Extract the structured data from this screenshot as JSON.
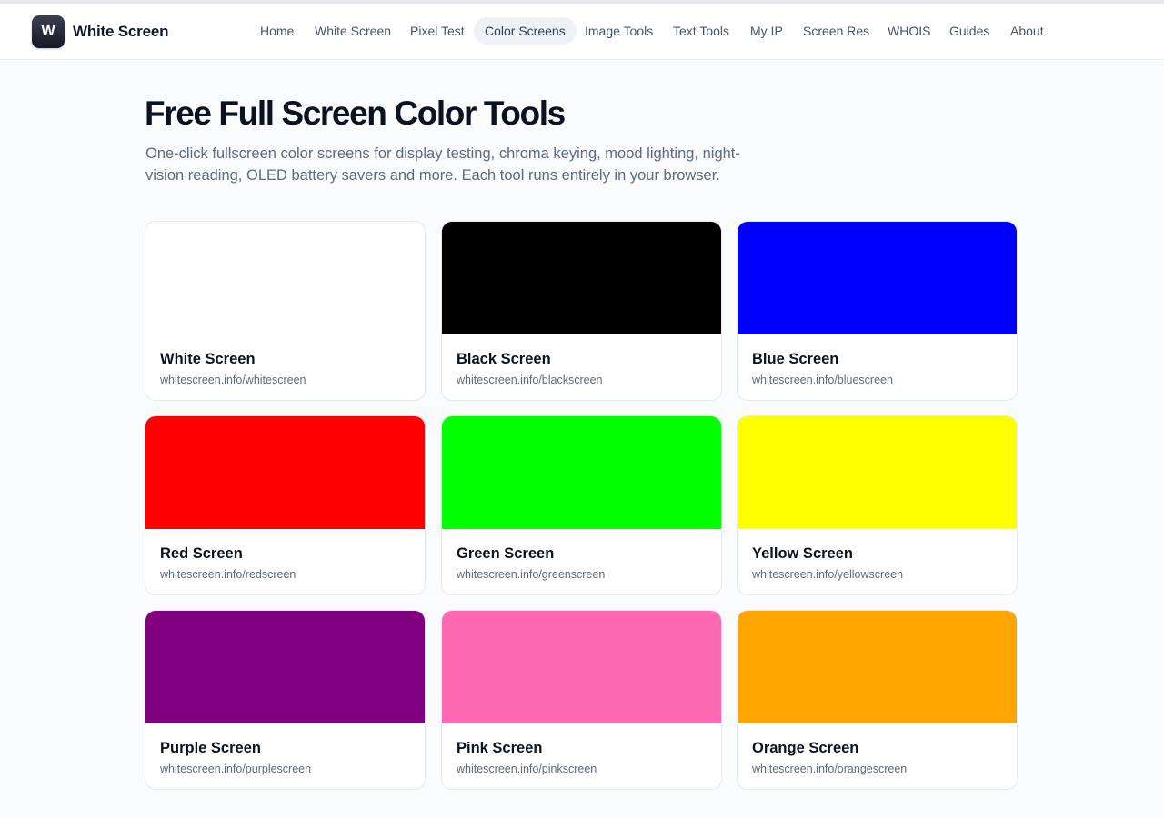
{
  "brand": {
    "logo_letter": "W",
    "name": "White Screen"
  },
  "nav": {
    "items": [
      {
        "label": "Home",
        "active": false
      },
      {
        "label": "White Screen",
        "active": false
      },
      {
        "label": "Pixel Test",
        "active": false
      },
      {
        "label": "Color Screens",
        "active": true
      },
      {
        "label": "Image Tools",
        "active": false
      },
      {
        "label": "Text Tools",
        "active": false
      },
      {
        "label": "My IP",
        "active": false
      },
      {
        "label": "Screen Res",
        "active": false
      },
      {
        "label": "WHOIS",
        "active": false
      },
      {
        "label": "Guides",
        "active": false
      },
      {
        "label": "About",
        "active": false
      }
    ]
  },
  "hero": {
    "title": "Free Full Screen Color Tools",
    "subtitle": "One-click fullscreen color screens for display testing, chroma keying, mood lighting, night-vision reading, OLED battery savers and more. Each tool runs entirely in your browser."
  },
  "cards": [
    {
      "title": "White Screen",
      "url": "whitescreen.info/whitescreen",
      "color": "#ffffff"
    },
    {
      "title": "Black Screen",
      "url": "whitescreen.info/blackscreen",
      "color": "#000000"
    },
    {
      "title": "Blue Screen",
      "url": "whitescreen.info/bluescreen",
      "color": "#0000ff"
    },
    {
      "title": "Red Screen",
      "url": "whitescreen.info/redscreen",
      "color": "#ff0000"
    },
    {
      "title": "Green Screen",
      "url": "whitescreen.info/greenscreen",
      "color": "#00ff00"
    },
    {
      "title": "Yellow Screen",
      "url": "whitescreen.info/yellowscreen",
      "color": "#ffff00"
    },
    {
      "title": "Purple Screen",
      "url": "whitescreen.info/purplescreen",
      "color": "#800080"
    },
    {
      "title": "Pink Screen",
      "url": "whitescreen.info/pinkscreen",
      "color": "#ff69b4"
    },
    {
      "title": "Orange Screen",
      "url": "whitescreen.info/orangescreen",
      "color": "#ffa500"
    }
  ]
}
